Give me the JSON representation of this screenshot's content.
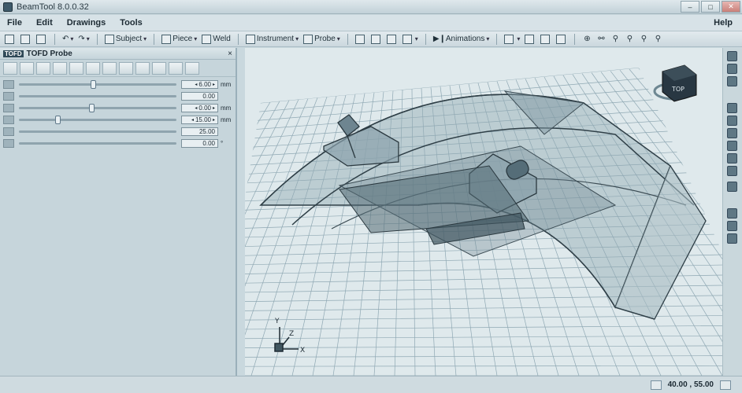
{
  "window": {
    "title": "BeamTool 8.0.0.32",
    "buttons": [
      "–",
      "□",
      "✕"
    ]
  },
  "menu": {
    "items": [
      "File",
      "Edit",
      "Drawings",
      "Tools"
    ],
    "help": "Help"
  },
  "toolbar": {
    "subject": "Subject",
    "piece": "Piece",
    "weld": "Weld",
    "instrument": "Instrument",
    "probe": "Probe",
    "animations": "Animations"
  },
  "panel": {
    "badge": "TOFD",
    "title": "TOFD Probe",
    "close": "×",
    "rows": [
      {
        "value": "6.00",
        "unit": "mm",
        "slider": 0.47
      },
      {
        "value": "0.00",
        "unit": "",
        "slider": null
      },
      {
        "value": "0.00",
        "unit": "mm",
        "slider": 0.46
      },
      {
        "value": "15.00",
        "unit": "mm",
        "slider": 0.24
      },
      {
        "value": "25.00",
        "unit": "",
        "slider": null
      },
      {
        "value": "0.00",
        "unit": "°",
        "slider": null
      }
    ]
  },
  "viewport": {
    "axis_y": "Y",
    "axis_z": "Z",
    "axis_x": "X",
    "cube_label": "TOP"
  },
  "status": {
    "coords": "40.00 , 55.00"
  }
}
